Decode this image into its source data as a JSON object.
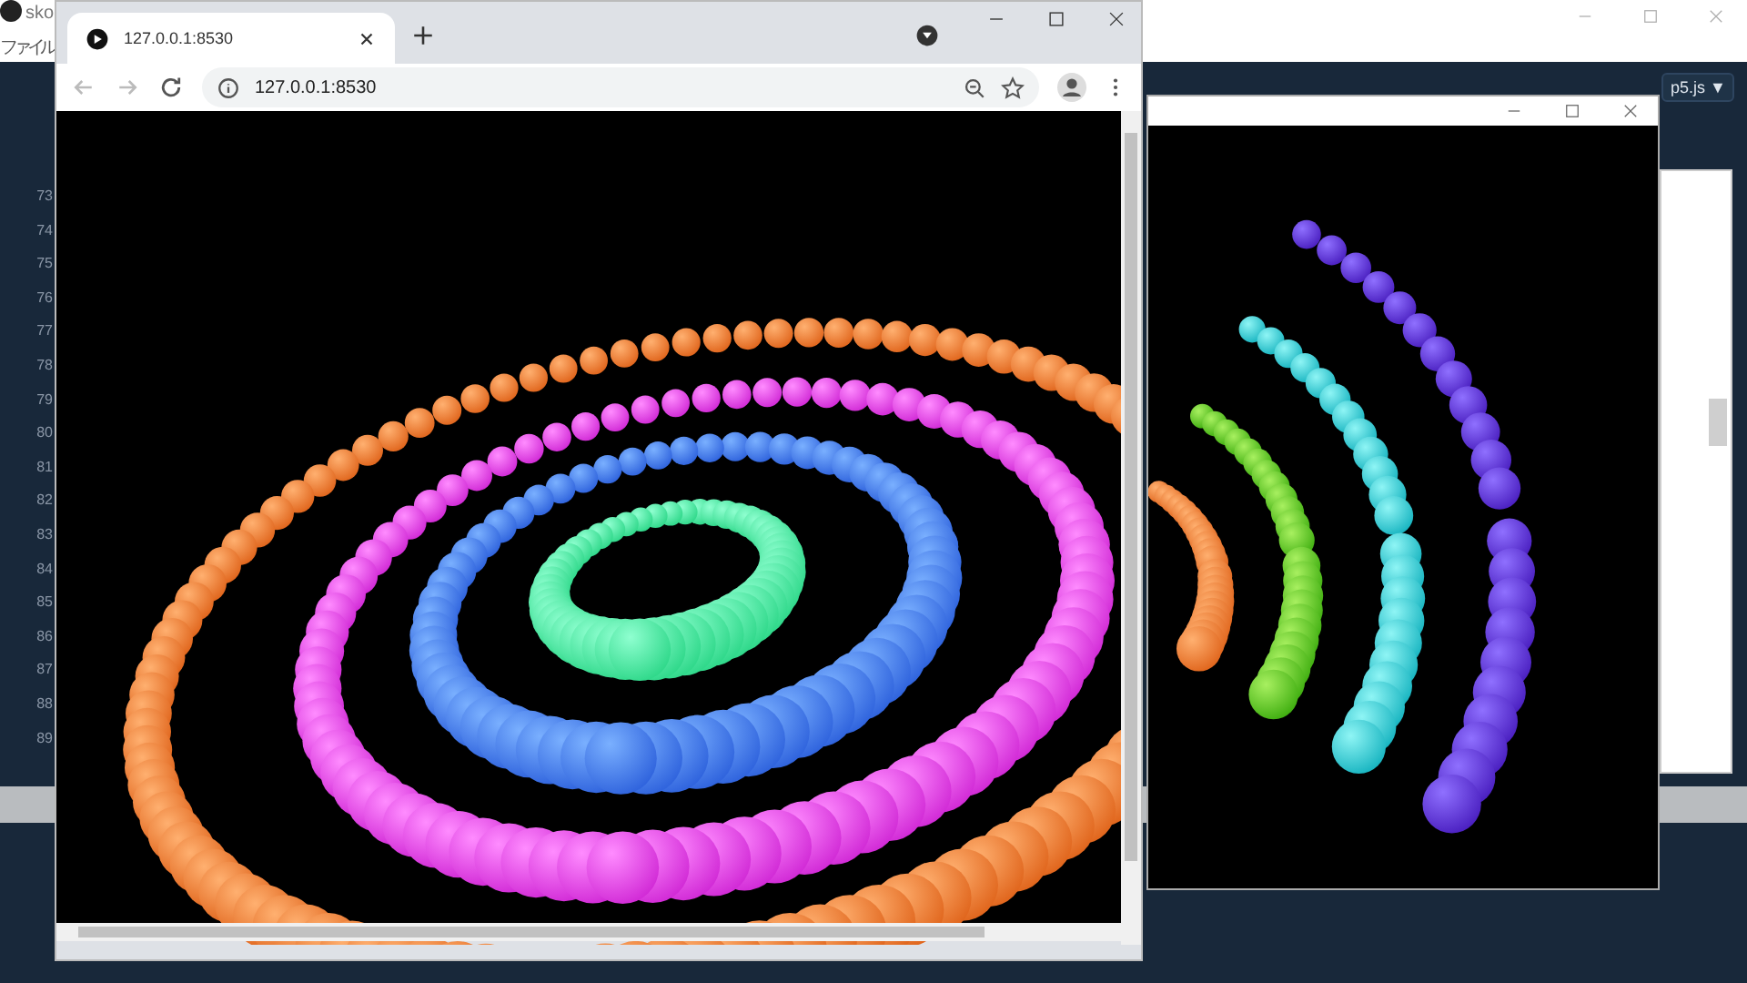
{
  "editor": {
    "title": "sko",
    "menu": [
      "ファイル"
    ],
    "line_numbers": [
      "73",
      "74",
      "75",
      "76",
      "77",
      "78",
      "79",
      "80",
      "81",
      "82",
      "83",
      "84",
      "85",
      "86",
      "87",
      "88",
      "89"
    ],
    "mode_selector": "p5.js ▼"
  },
  "browser": {
    "tab": {
      "title": "127.0.0.1:8530"
    },
    "address": "127.0.0.1:8530"
  }
}
